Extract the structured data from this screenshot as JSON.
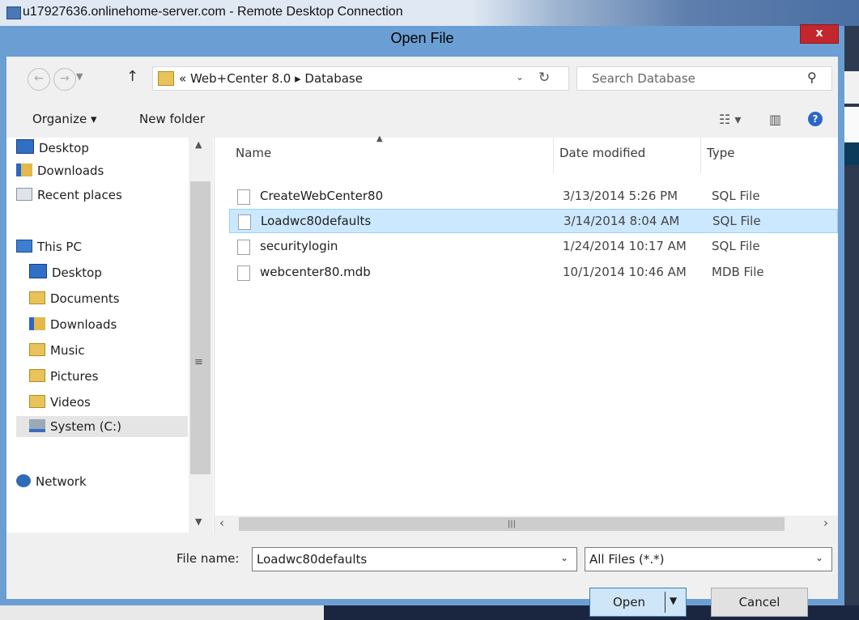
{
  "rdp": {
    "title": "u17927636.onlinehome-server.com - Remote Desktop Connection"
  },
  "dialog": {
    "title": "Open File",
    "close_label": "x"
  },
  "nav": {
    "back": "←",
    "forward": "→",
    "up": "↑",
    "breadcrumb": "« Web+Center 8.0 ▸ Database",
    "search_placeholder": "Search Database"
  },
  "toolbar": {
    "organize": "Organize ▾",
    "new_folder": "New folder",
    "view_icon": "☷ ▾",
    "help": "?"
  },
  "sidebar": {
    "items": [
      {
        "label": "Desktop",
        "icon": "desktop-icon"
      },
      {
        "label": "Downloads",
        "icon": "downloads-icon"
      },
      {
        "label": "Recent places",
        "icon": "recent-places-icon"
      },
      {
        "label": "This PC",
        "icon": "this-pc-icon"
      },
      {
        "label": "Desktop",
        "icon": "desktop-icon"
      },
      {
        "label": "Documents",
        "icon": "documents-icon"
      },
      {
        "label": "Downloads",
        "icon": "downloads-icon"
      },
      {
        "label": "Music",
        "icon": "music-icon"
      },
      {
        "label": "Pictures",
        "icon": "pictures-icon"
      },
      {
        "label": "Videos",
        "icon": "videos-icon"
      },
      {
        "label": "System (C:)",
        "icon": "drive-icon"
      },
      {
        "label": "Network",
        "icon": "network-icon"
      }
    ],
    "selected": "System (C:)"
  },
  "files": {
    "columns": [
      "Name",
      "Date modified",
      "Type"
    ],
    "rows": [
      {
        "name": "CreateWebCenter80",
        "date": "3/13/2014 5:26 PM",
        "type": "SQL File"
      },
      {
        "name": "Loadwc80defaults",
        "date": "3/14/2014 8:04 AM",
        "type": "SQL File"
      },
      {
        "name": "securitylogin",
        "date": "1/24/2014 10:17 AM",
        "type": "SQL File"
      },
      {
        "name": "webcenter80.mdb",
        "date": "10/1/2014 10:46 AM",
        "type": "MDB File"
      }
    ],
    "selected": "Loadwc80defaults"
  },
  "footer": {
    "file_name_label": "File name:",
    "file_name_value": "Loadwc80defaults",
    "file_type_value": "All Files (*.*)",
    "open_label": "Open",
    "cancel_label": "Cancel"
  }
}
